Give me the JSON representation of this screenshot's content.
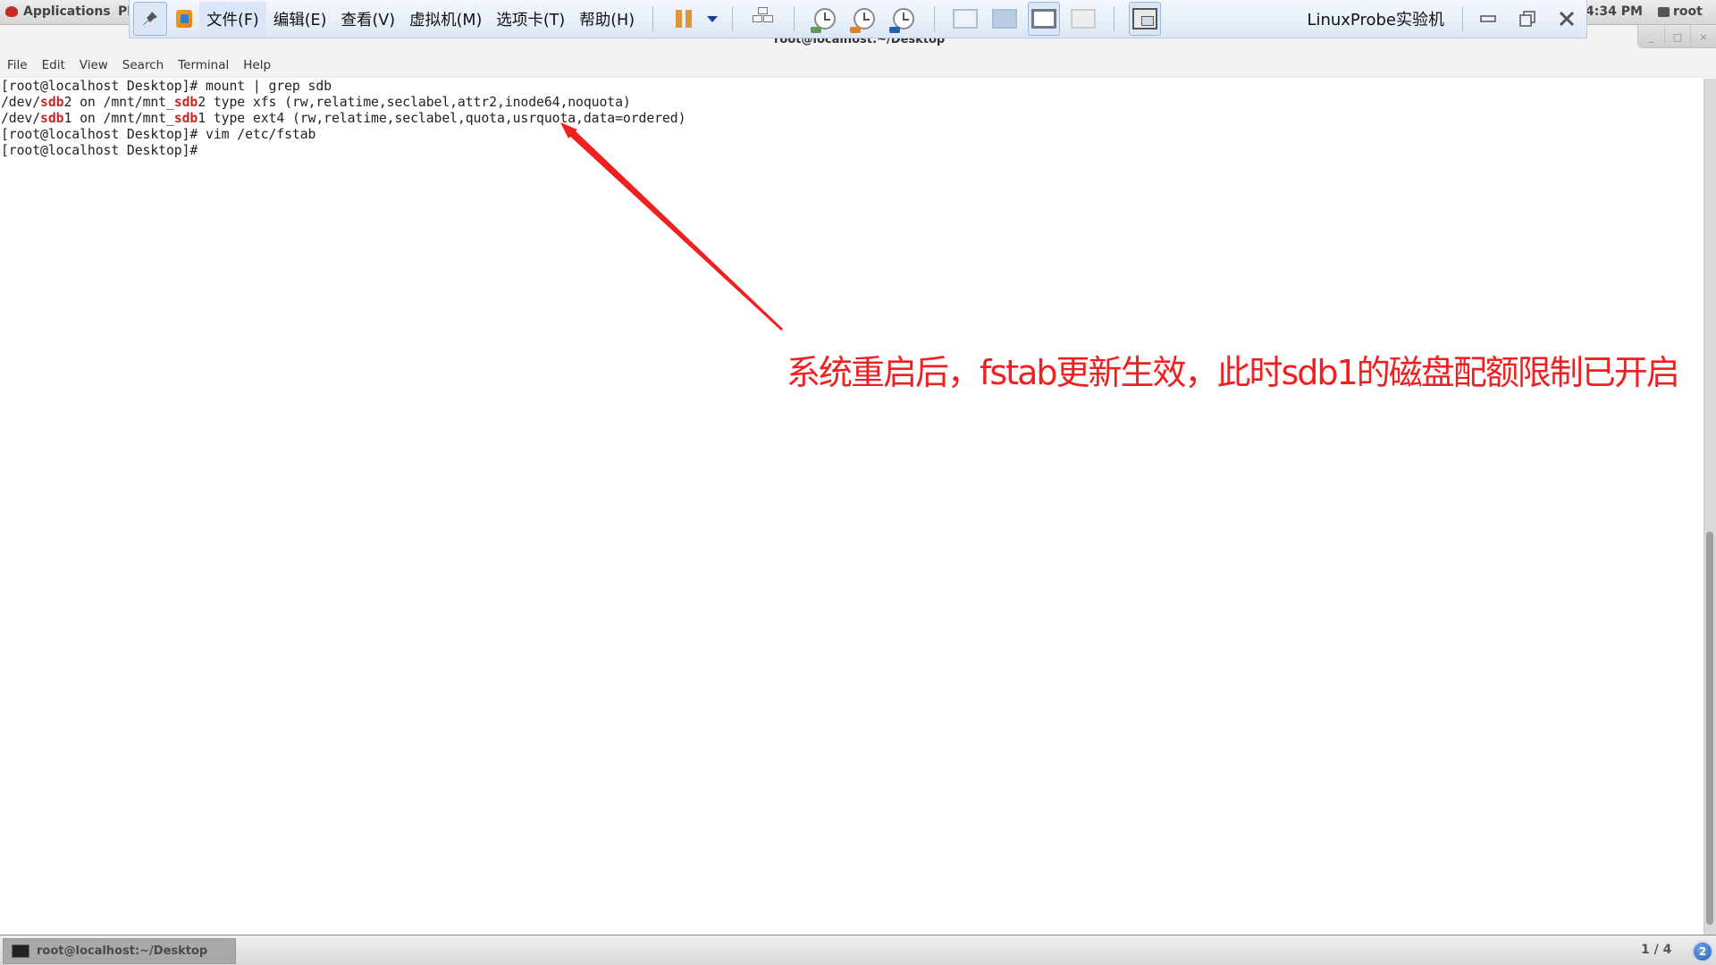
{
  "gnome_bar": {
    "applications_label": "Applications",
    "places_label": "Pl",
    "clock": "4:34 PM",
    "user": "root"
  },
  "terminal": {
    "window_title": "root@localhost:~/Desktop",
    "menu": [
      "File",
      "Edit",
      "View",
      "Search",
      "Terminal",
      "Help"
    ],
    "lines": [
      [
        {
          "t": "[root@localhost Desktop]# mount | grep sdb"
        }
      ],
      [
        {
          "t": "/dev/"
        },
        {
          "t": "sdb",
          "hl": true
        },
        {
          "t": "2 on /mnt/mnt_"
        },
        {
          "t": "sdb",
          "hl": true
        },
        {
          "t": "2 type xfs (rw,relatime,seclabel,attr2,inode64,noquota)"
        }
      ],
      [
        {
          "t": "/dev/"
        },
        {
          "t": "sdb",
          "hl": true
        },
        {
          "t": "1 on /mnt/mnt_"
        },
        {
          "t": "sdb",
          "hl": true
        },
        {
          "t": "1 type ext4 (rw,relatime,seclabel,quota,usrquota,data=ordered)"
        }
      ],
      [
        {
          "t": "[root@localhost Desktop]# vim /etc/fstab"
        }
      ],
      [
        {
          "t": "[root@localhost Desktop]# "
        }
      ]
    ],
    "highlight_color": "#c62828",
    "window_controls": [
      "_",
      "□",
      "×"
    ]
  },
  "vmware_toolbar": {
    "menus": [
      "文件(F)",
      "编辑(E)",
      "查看(V)",
      "虚拟机(M)",
      "选项卡(T)",
      "帮助(H)"
    ],
    "vm_name": "LinuxProbe实验机",
    "icons": [
      "pin-icon",
      "vmware-logo-icon",
      "pause-icon",
      "dropdown-icon",
      "send-ctrl-alt-del-icon",
      "snapshot-take-icon",
      "snapshot-revert-icon",
      "snapshot-manager-icon",
      "console-view-icon",
      "thumbnail-view-icon",
      "fullscreen-icon",
      "unity-icon",
      "library-view-icon"
    ],
    "window_buttons": [
      "minimize",
      "restore",
      "close"
    ]
  },
  "annotation": {
    "text": "系统重启后，fstab更新生效，此时sdb1的磁盘配额限制已开启",
    "color": "#f02020"
  },
  "taskbar": {
    "task_label": "root@localhost:~/Desktop",
    "workspace": "1 / 4",
    "notification_count": "2"
  }
}
